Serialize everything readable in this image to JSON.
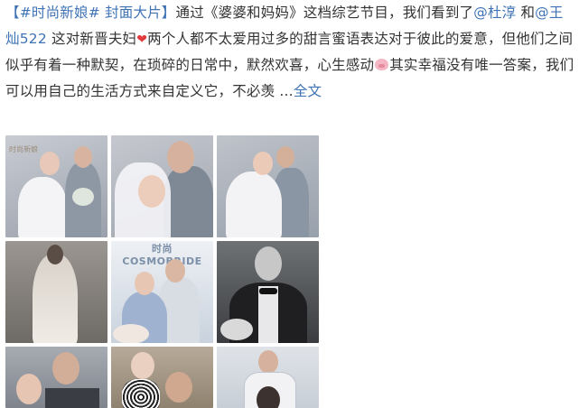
{
  "post": {
    "tag": "【#时尚新娘# 封面大片】",
    "t1": "通过《婆婆和妈妈》这档综艺节目，我们看到了",
    "mention1": "@杜淳",
    "t2": " 和",
    "mention2": "@王灿522",
    "t3": " 这对新晋夫妇",
    "t4": "两个人都不太爱用过多的甜言蜜语表达对于彼此的爱意，但他们之间似乎有着一种默契，在琐碎的日常中，默然欢喜，心生感动",
    "t5": "其实幸福没有唯一答案，我们可以用自己的生活方式来自定义它，不必羡 ...",
    "full": "全文"
  },
  "photos": {
    "p1_logo": "时尚新娘",
    "p5_mag": "时尚 COSMOBRIDE"
  },
  "colors": {
    "link": "#3f73b5",
    "text": "#333333",
    "heart": "#e23b3b"
  }
}
